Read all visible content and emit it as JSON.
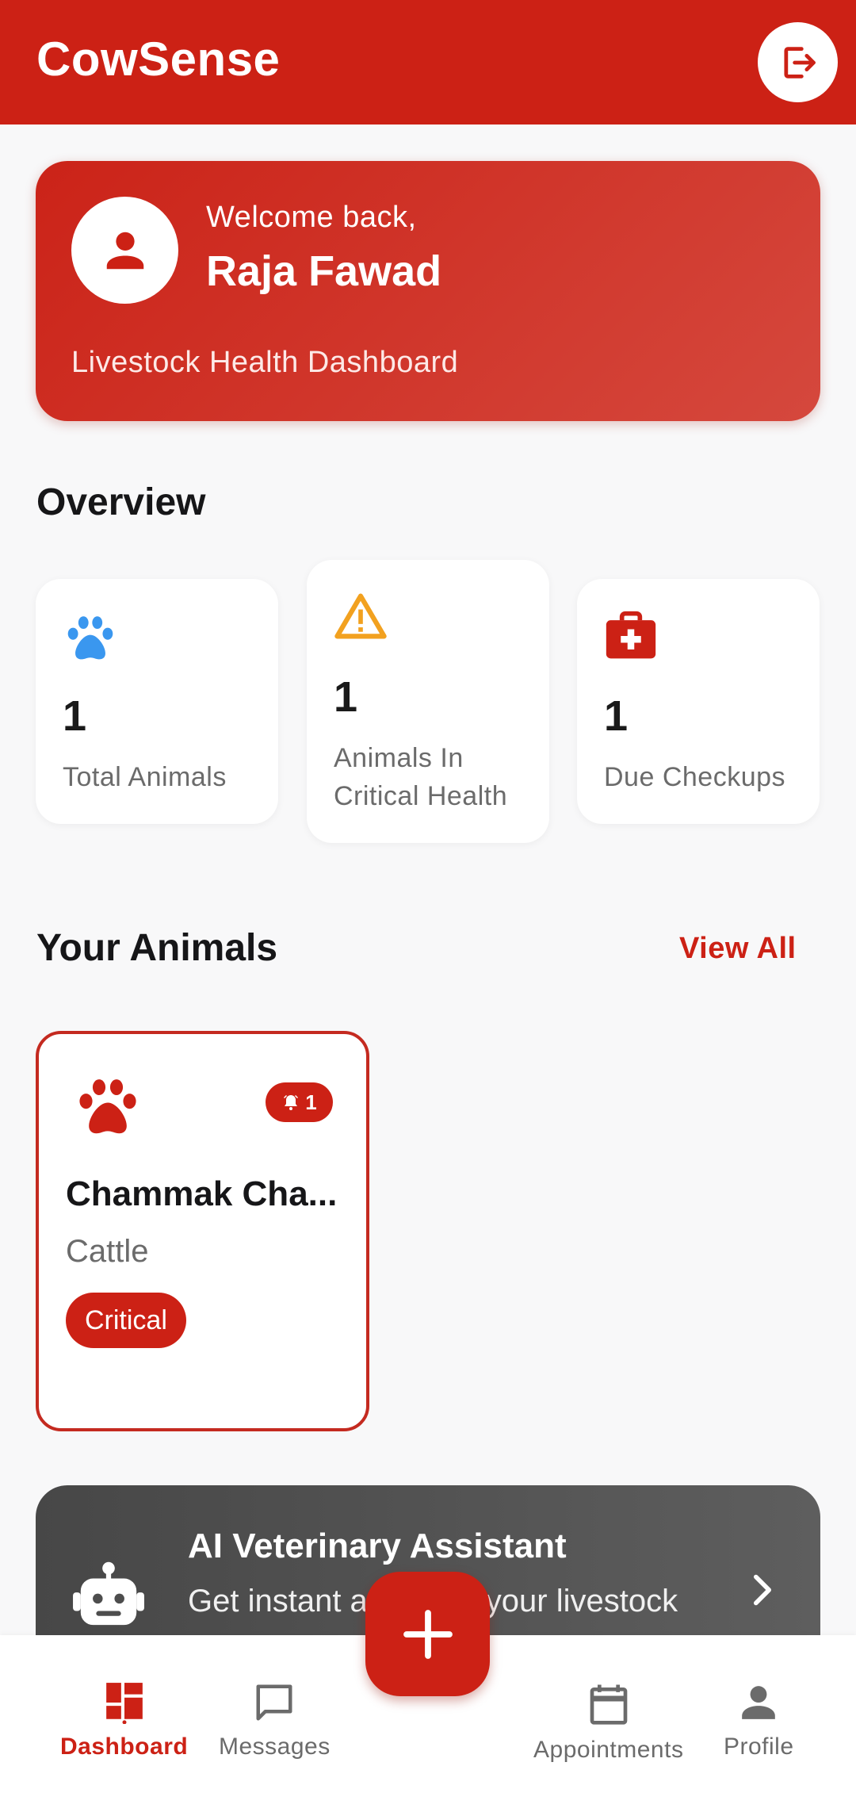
{
  "app": {
    "title": "CowSense"
  },
  "colors": {
    "primary": "#cc2115",
    "warning": "#f2a11f",
    "info": "#3a97ef",
    "dark": "#4f4f4f"
  },
  "header": {
    "logout_icon": "logout-icon"
  },
  "welcome": {
    "greeting": "Welcome back,",
    "user_name": "Raja Fawad",
    "subtitle": "Livestock Health Dashboard",
    "avatar_icon": "person-icon"
  },
  "overview": {
    "title": "Overview",
    "stats": [
      {
        "value": "1",
        "label": "Total Animals",
        "icon": "paw-icon"
      },
      {
        "value": "1",
        "label_line1": "Animals In",
        "label_line2": "Critical Health",
        "icon": "warning-icon"
      },
      {
        "value": "1",
        "label": "Due Checkups",
        "icon": "medical-kit-icon"
      }
    ]
  },
  "animals": {
    "title": "Your Animals",
    "view_all": "View All",
    "items": [
      {
        "name": "Chammak Cha...",
        "type": "Cattle",
        "status": "Critical",
        "alert_count": "1",
        "icon": "paw-icon"
      }
    ]
  },
  "assistant": {
    "title": "AI Veterinary Assistant",
    "subtitle": "Get instant advice to your livestock",
    "icon": "robot-icon"
  },
  "fab": {
    "icon": "plus-icon"
  },
  "bottom_nav": [
    {
      "label": "Dashboard",
      "icon": "dashboard-icon",
      "active": true
    },
    {
      "label": "Messages",
      "icon": "message-icon",
      "active": false
    },
    {
      "label": "Appointments",
      "icon": "calendar-icon",
      "active": false
    },
    {
      "label": "Profile",
      "icon": "person-icon",
      "active": false
    }
  ]
}
